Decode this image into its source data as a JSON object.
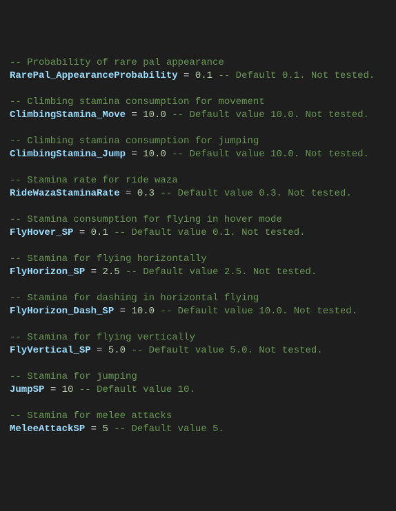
{
  "colors": {
    "background": "#1e1e1e",
    "default_text": "#d4d4d4",
    "comment": "#6a9955",
    "variable": "#9cdcfe",
    "number": "#b5cea8"
  },
  "entries": [
    {
      "comment": "-- Probability of rare pal appearance",
      "variable": "RarePal_AppearanceProbability",
      "assign_prefix": " = ",
      "value": "0.1",
      "inline": " -- Default 0.1. Not tested."
    },
    {
      "comment": "-- Climbing stamina consumption for movement",
      "variable": "ClimbingStamina_Move",
      "assign_prefix": " = ",
      "value": "10.0",
      "inline": " -- Default value 10.0. Not tested."
    },
    {
      "comment": "-- Climbing stamina consumption for jumping",
      "variable": "ClimbingStamina_Jump",
      "assign_prefix": " = ",
      "value": "10.0",
      "inline": " -- Default value 10.0. Not tested."
    },
    {
      "comment": "-- Stamina rate for ride waza",
      "variable": "RideWazaStaminaRate",
      "assign_prefix": " = ",
      "value": "0.3",
      "inline": " -- Default value 0.3. Not tested."
    },
    {
      "comment": "-- Stamina consumption for flying in hover mode",
      "variable": "FlyHover_SP",
      "assign_prefix": " = ",
      "value": "0.1",
      "inline": " -- Default value 0.1. Not tested."
    },
    {
      "comment": "-- Stamina for flying horizontally",
      "variable": "FlyHorizon_SP",
      "assign_prefix": " = ",
      "value": "2.5",
      "inline": " -- Default value 2.5. Not tested."
    },
    {
      "comment": "-- Stamina for dashing in horizontal flying",
      "variable": "FlyHorizon_Dash_SP",
      "assign_prefix": " = ",
      "value": "10.0",
      "inline": " -- Default value 10.0. Not tested."
    },
    {
      "comment": "-- Stamina for flying vertically",
      "variable": "FlyVertical_SP",
      "assign_prefix": " = ",
      "value": "5.0",
      "inline": " -- Default value 5.0. Not tested."
    },
    {
      "comment": "-- Stamina for jumping",
      "variable": "JumpSP",
      "assign_prefix": " = ",
      "value": "10",
      "inline": " -- Default value 10."
    },
    {
      "comment": "-- Stamina for melee attacks",
      "variable": "MeleeAttackSP",
      "assign_prefix": " = ",
      "value": "5",
      "inline": " -- Default value 5."
    }
  ]
}
